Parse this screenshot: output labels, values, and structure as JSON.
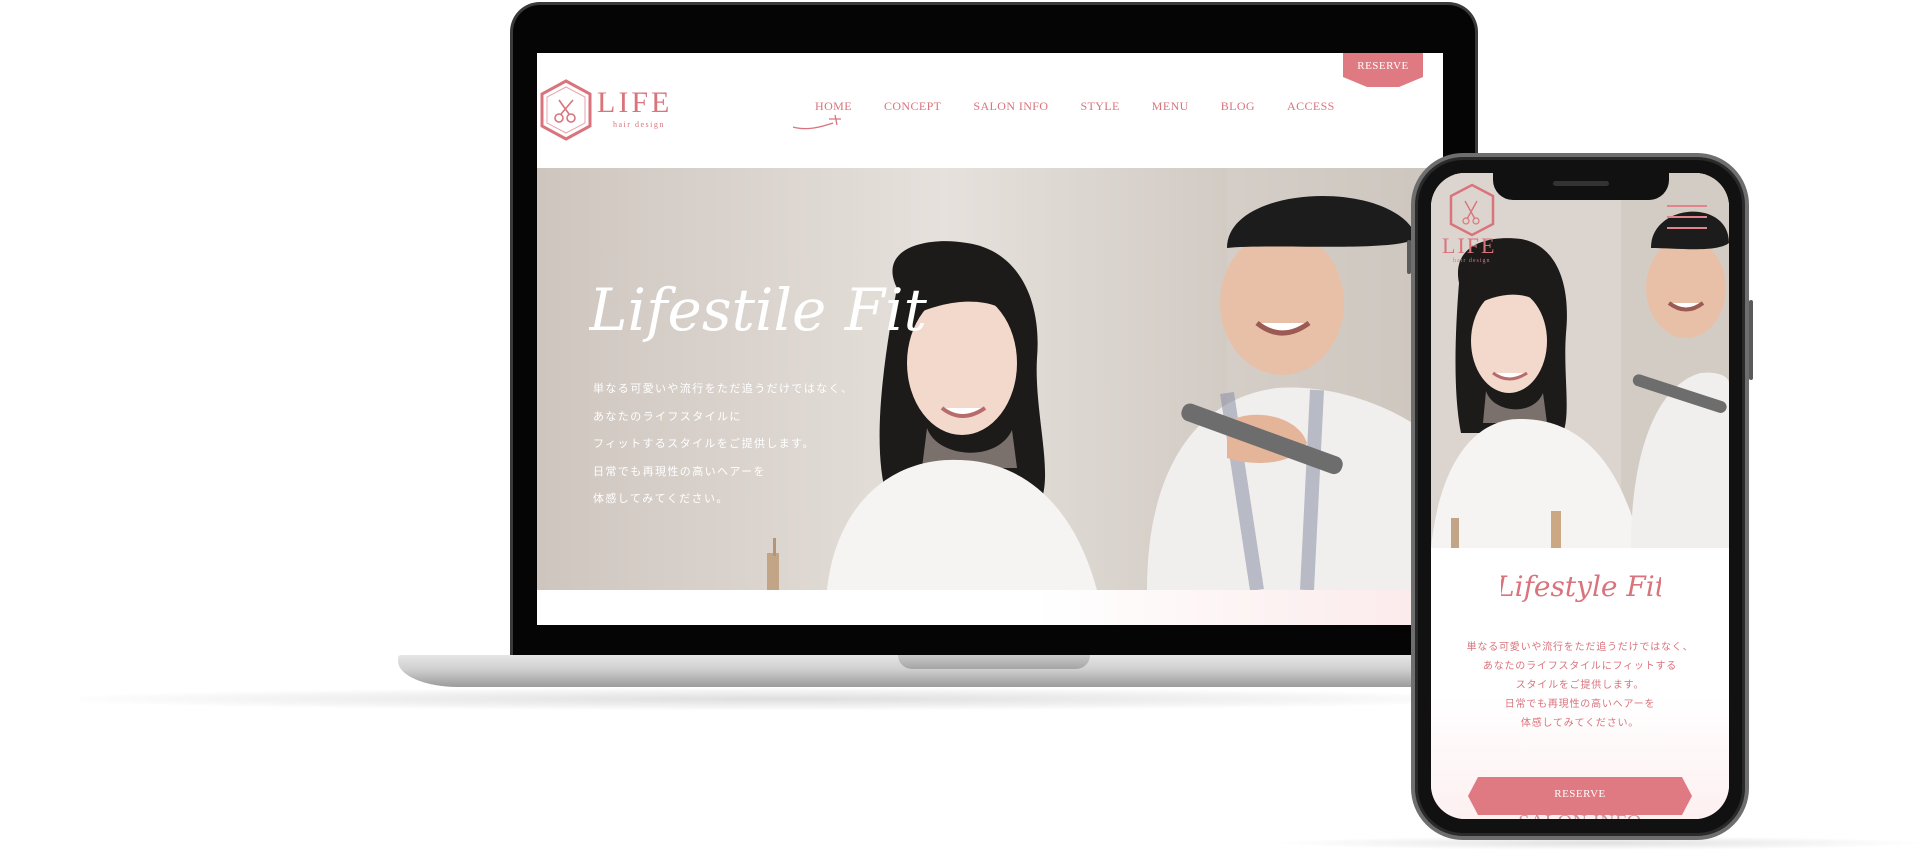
{
  "desktop": {
    "logo": {
      "brand": "LIFE",
      "sub": "hair design"
    },
    "nav": [
      "HOME",
      "CONCEPT",
      "SALON INFO",
      "STYLE",
      "MENU",
      "BLOG",
      "ACCESS"
    ],
    "reserve_label": "RESERVE",
    "hero": {
      "title": "Lifestile Fit",
      "lines": [
        "単なる可愛いや流行をただ追うだけではなく、",
        "あなたのライフスタイルに",
        "フィットするスタイルをご提供します。",
        "日常でも再現性の高いヘアーを",
        "体感してみてください。"
      ]
    }
  },
  "mobile": {
    "logo": {
      "brand": "LIFE",
      "sub": "hair design"
    },
    "title": "Lifestyle Fit",
    "lines": [
      "単なる可愛いや流行をただ追うだけではなく、",
      "あなたのライフスタイルにフィットする",
      "スタイルをご提供します。",
      "日常でも再現性の高いヘアーを",
      "体感してみてください。"
    ],
    "reserve_label": "RESERVE",
    "next_section": "SALON INFO"
  },
  "colors": {
    "accent": "#d9747c",
    "button": "#e07a82",
    "hero_text": "#ffffff"
  },
  "icons": [
    "scissors-hex-logo-icon",
    "menu-hamburger-icon"
  ]
}
